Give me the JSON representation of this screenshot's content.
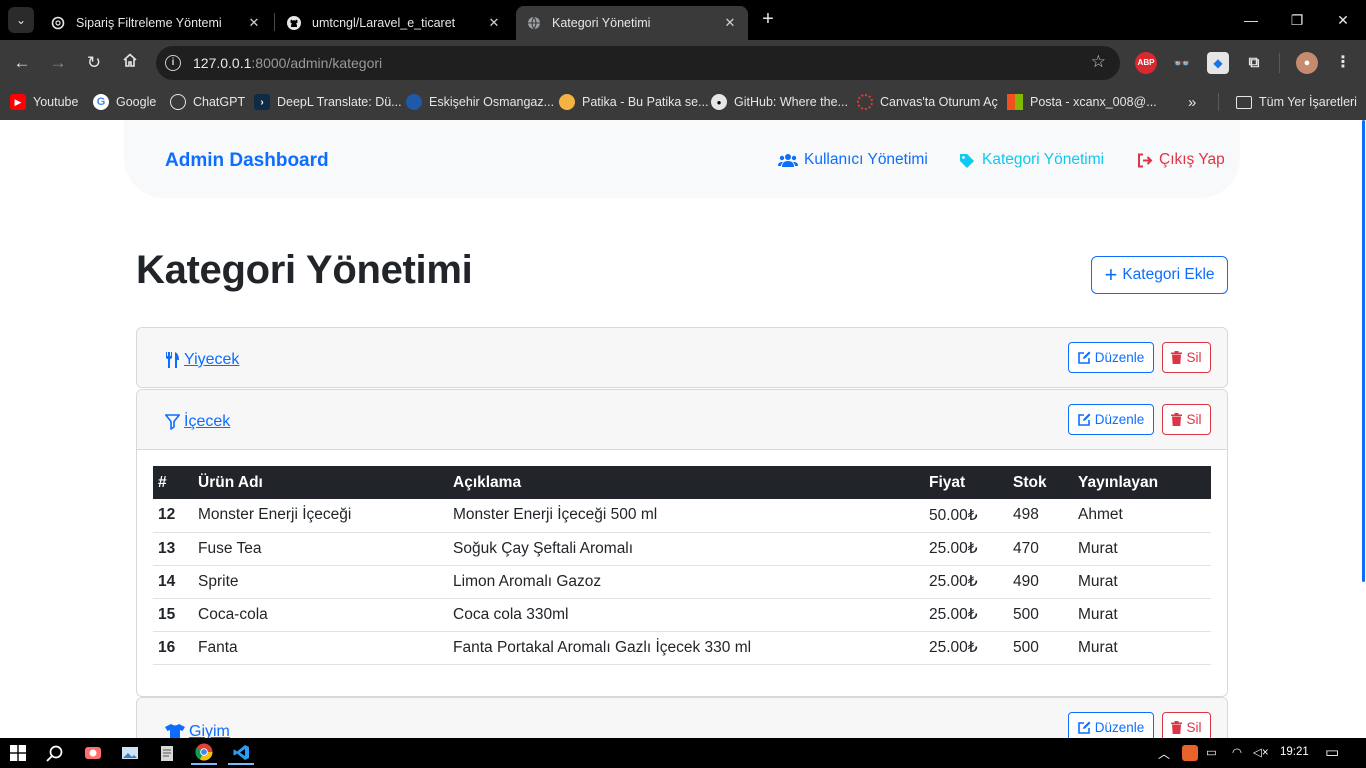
{
  "browser": {
    "tabs": [
      {
        "title": "Sipariş Filtreleme Yöntemi",
        "icon": "chatgpt-icon",
        "active": false
      },
      {
        "title": "umtcngl/Laravel_e_ticaret",
        "icon": "github-icon",
        "active": false
      },
      {
        "title": "Kategori Yönetimi",
        "icon": "globe-icon",
        "active": true
      }
    ],
    "url_host": "127.0.0.1",
    "url_rest": ":8000/admin/kategori",
    "bookmarks": [
      {
        "label": "Youtube",
        "icon": "youtube-icon",
        "color": "#ff0000"
      },
      {
        "label": "Google",
        "icon": "google-icon",
        "color": "#ffffff"
      },
      {
        "label": "ChatGPT",
        "icon": "chatgpt-icon",
        "color": "#ffffff"
      },
      {
        "label": "DeepL Translate: Dü...",
        "icon": "deepl-icon",
        "color": "#0f2b46"
      },
      {
        "label": "Eskişehir Osmangaz...",
        "icon": "university-icon",
        "color": "#1e5aa8"
      },
      {
        "label": "Patika - Bu Patika se...",
        "icon": "patika-icon",
        "color": "#f5b342"
      },
      {
        "label": "GitHub: Where the...",
        "icon": "github-icon",
        "color": "#ffffff"
      },
      {
        "label": "Canvas'ta Oturum Aç",
        "icon": "canvas-icon",
        "color": "#e13c2a"
      },
      {
        "label": "Posta - xcanx_008@...",
        "icon": "microsoft-icon",
        "color": "#f25022"
      }
    ],
    "all_bookmarks": "Tüm Yer İşaretleri"
  },
  "navbar": {
    "brand": "Admin Dashboard",
    "links": [
      {
        "label": "Kullanıcı Yönetimi",
        "icon": "users-icon",
        "color": "#0d6efd"
      },
      {
        "label": "Kategori Yönetimi",
        "icon": "tags-icon",
        "color": "#0dcaf0"
      },
      {
        "label": "Çıkış Yap",
        "icon": "sign-out-icon",
        "color": "#dc3545"
      }
    ]
  },
  "page": {
    "title": "Kategori Yönetimi",
    "add_button": "Kategori Ekle",
    "edit_label": "Düzenle",
    "delete_label": "Sil"
  },
  "categories": [
    {
      "name": "Yiyecek",
      "icon": "utensils-icon"
    },
    {
      "name": "İçecek",
      "icon": "filter-icon"
    },
    {
      "name": "Giyim",
      "icon": "tshirt-icon"
    }
  ],
  "products_table": {
    "columns": [
      "#",
      "Ürün Adı",
      "Açıklama",
      "Fiyat",
      "Stok",
      "Yayınlayan"
    ],
    "rows": [
      {
        "id": "12",
        "name": "Monster Enerji İçeceği",
        "desc": "Monster Enerji İçeceği 500 ml",
        "price": "50.00₺",
        "stock": "498",
        "publisher": "Ahmet"
      },
      {
        "id": "13",
        "name": "Fuse Tea",
        "desc": "Soğuk Çay Şeftali Aromalı",
        "price": "25.00₺",
        "stock": "470",
        "publisher": "Murat"
      },
      {
        "id": "14",
        "name": "Sprite",
        "desc": "Limon Aromalı Gazoz",
        "price": "25.00₺",
        "stock": "490",
        "publisher": "Murat"
      },
      {
        "id": "15",
        "name": "Coca-cola",
        "desc": "Coca cola 330ml",
        "price": "25.00₺",
        "stock": "500",
        "publisher": "Murat"
      },
      {
        "id": "16",
        "name": "Fanta",
        "desc": "Fanta Portakal Aromalı Gazlı İçecek 330 ml",
        "price": "25.00₺",
        "stock": "500",
        "publisher": "Murat"
      }
    ]
  },
  "taskbar": {
    "time": "19:21"
  }
}
